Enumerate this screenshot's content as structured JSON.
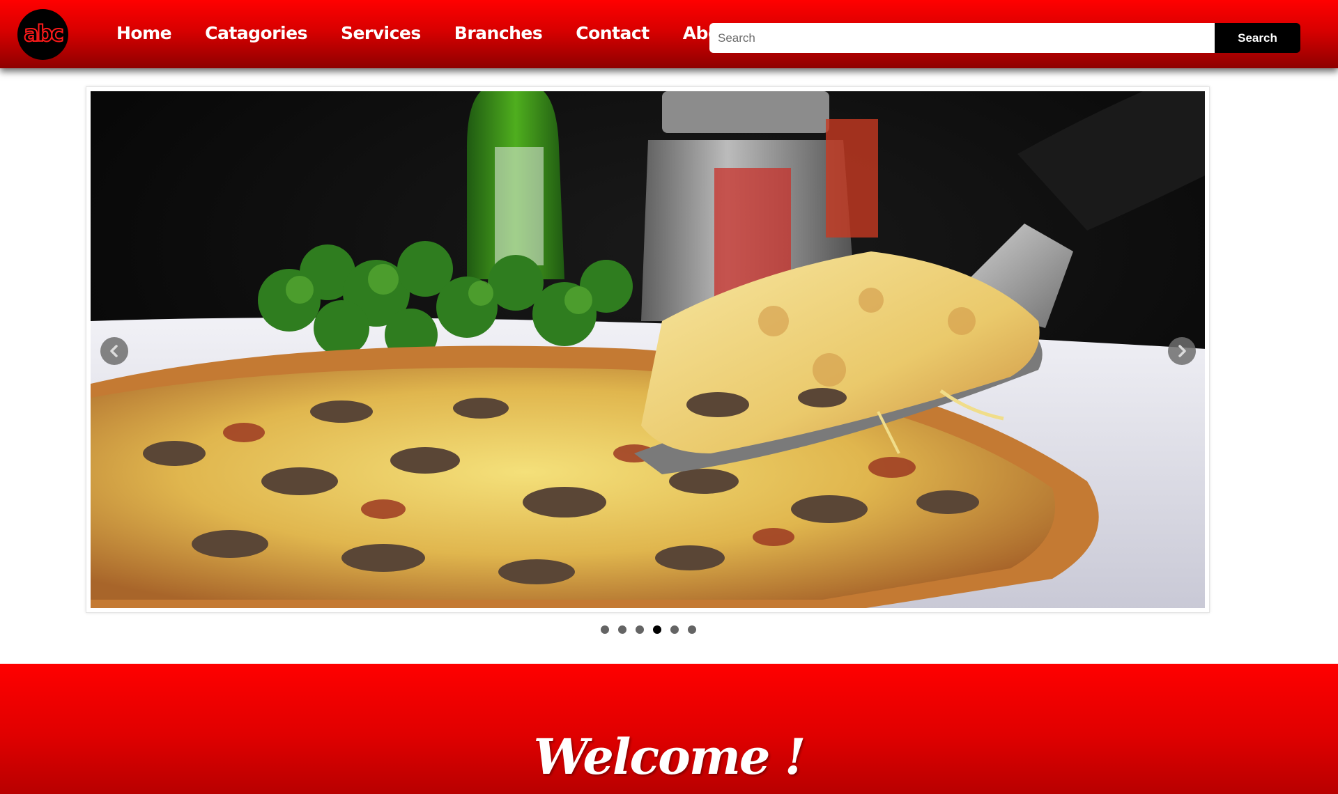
{
  "brand": {
    "logo_text": "abc",
    "accent_color": "#ff0000",
    "dark_accent": "#8e0000"
  },
  "nav": {
    "items": [
      {
        "label": "Home"
      },
      {
        "label": "Catagories"
      },
      {
        "label": "Services"
      },
      {
        "label": "Branches"
      },
      {
        "label": "Contact"
      },
      {
        "label": "About"
      }
    ]
  },
  "search": {
    "placeholder": "Search",
    "value": "",
    "button_label": "Search"
  },
  "carousel": {
    "slide_count": 6,
    "active_index": 3,
    "slide_subject": "pizza-photo",
    "prev_icon": "chevron-left-icon",
    "next_icon": "chevron-right-icon"
  },
  "welcome": {
    "title": "Welcome !"
  }
}
